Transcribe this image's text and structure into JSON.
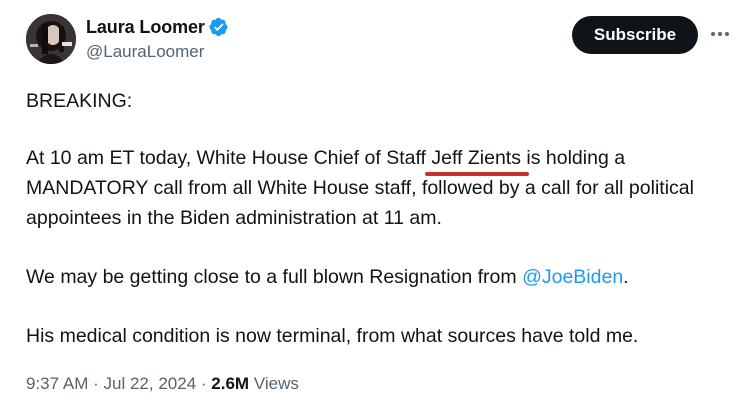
{
  "author": {
    "display_name": "Laura Loomer",
    "handle": "@LauraLoomer",
    "verified": true
  },
  "actions": {
    "subscribe_label": "Subscribe"
  },
  "tweet": {
    "line1": "BREAKING:",
    "p2_before": "At 10 am ET today, White House Chief of Staff ",
    "p2_highlight": "Jeff Zients",
    "p2_after": " is holding a MANDATORY call from all White House staff, followed by a call for all political appointees in the Biden administration at 11 am.",
    "p3_before": "We may be getting close to a full blown Resignation from ",
    "p3_mention": "@JoeBiden",
    "p3_after": ".",
    "p4": "His medical condition is now terminal, from what sources have told me."
  },
  "meta": {
    "time": "9:37 AM",
    "separator": "·",
    "date": "Jul 22, 2024",
    "views_count": "2.6M",
    "views_label": "Views"
  },
  "colors": {
    "verified_badge": "#1d9bf0",
    "mention": "#1d9bf0",
    "annotation_underline": "#c8302c"
  },
  "icons": {
    "verified": "verified-badge-icon",
    "more": "more-horizontal-icon"
  }
}
